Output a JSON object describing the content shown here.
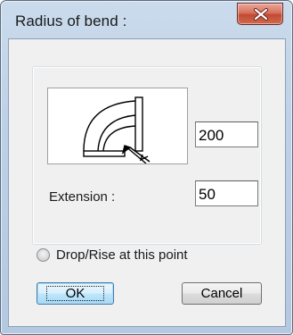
{
  "window": {
    "title": "Radius of bend :",
    "close_icon": "close-icon"
  },
  "diagram": {
    "icon": "pipe-bend-icon"
  },
  "radius_field": {
    "value": "200"
  },
  "extension": {
    "label": "Extension :",
    "value": "50"
  },
  "option": {
    "label": "Drop/Rise at this point",
    "checked": false
  },
  "buttons": {
    "ok": "OK",
    "cancel": "Cancel"
  }
}
